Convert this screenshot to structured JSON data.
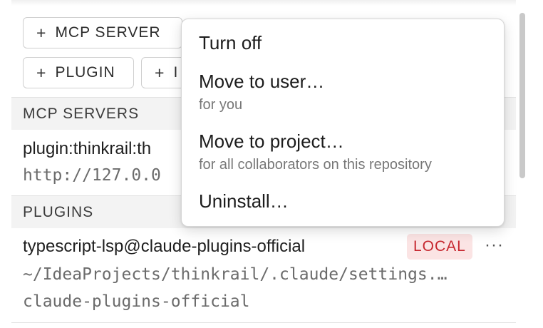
{
  "toolbar": {
    "buttons": [
      {
        "label": "MCP SERVER"
      },
      {
        "label": "PLUGIN"
      },
      {
        "label": "I"
      }
    ],
    "plus_symbol": "+"
  },
  "sections": {
    "mcp_servers": {
      "header": "MCP SERVERS",
      "item": {
        "name": "plugin:thinkrail:th",
        "url": "http://127.0.0"
      }
    },
    "plugins": {
      "header": "PLUGINS",
      "item": {
        "name": "typescript-lsp@claude-plugins-official",
        "badge": "LOCAL",
        "more": "···",
        "path": "~/IdeaProjects/thinkrail/.claude/settings.…",
        "source": "claude-plugins-official"
      }
    }
  },
  "context_menu": {
    "items": [
      {
        "label": "Turn off",
        "sub": ""
      },
      {
        "label": "Move to user…",
        "sub": "for you"
      },
      {
        "label": "Move to project…",
        "sub": "for all collaborators on this repository"
      },
      {
        "label": "Uninstall…",
        "sub": ""
      }
    ]
  },
  "colors": {
    "badge_bg": "#fbe4e4",
    "badge_text": "#c6262e",
    "section_bg": "#f3f3f3"
  }
}
